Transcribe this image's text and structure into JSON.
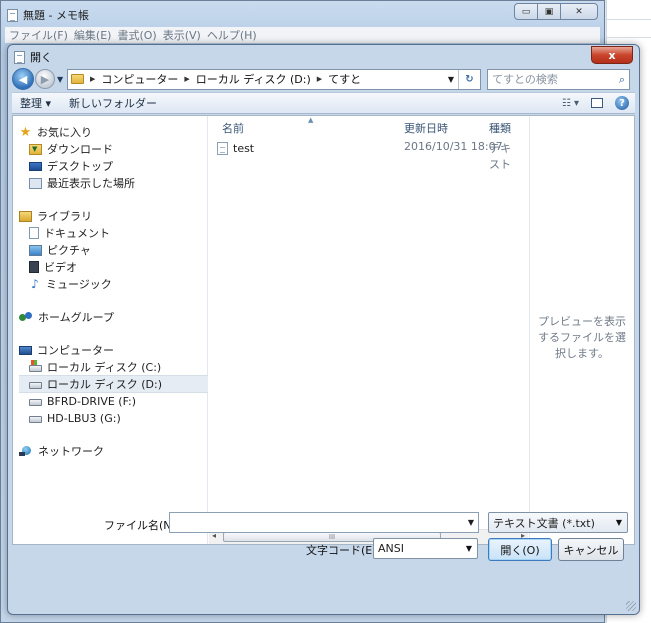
{
  "notepad": {
    "title": "無題 - メモ帳",
    "menu": [
      "ファイル(F)",
      "編集(E)",
      "書式(O)",
      "表示(V)",
      "ヘルプ(H)"
    ],
    "caption_buttons": {
      "minimize": "▭",
      "maximize": "▣",
      "close": "✕"
    }
  },
  "dialog": {
    "title": "開く",
    "close_glyph": "x",
    "address": {
      "crumbs": [
        "コンピューター",
        "ローカル ディスク (D:)",
        "てすと"
      ],
      "search_placeholder": "てすとの検索"
    },
    "toolbar": {
      "organize": "整理 ▾",
      "new_folder": "新しいフォルダー"
    },
    "nav": {
      "favorites": "お気に入り",
      "downloads": "ダウンロード",
      "desktop": "デスクトップ",
      "recent": "最近表示した場所",
      "libraries": "ライブラリ",
      "documents": "ドキュメント",
      "pictures": "ピクチャ",
      "videos": "ビデオ",
      "music": "ミュージック",
      "homegroup": "ホームグループ",
      "computer": "コンピューター",
      "drive_c": "ローカル ディスク (C:)",
      "drive_d": "ローカル ディスク (D:)",
      "drive_f": "BFRD-DRIVE (F:)",
      "drive_g": "HD-LBU3 (G:)",
      "network": "ネットワーク",
      "selected": "ローカル ディスク (D:)"
    },
    "columns": {
      "name": "名前",
      "modified": "更新日時",
      "type": "種類"
    },
    "files": [
      {
        "name": "test",
        "modified": "2016/10/31 18:07",
        "type": "テキスト"
      }
    ],
    "preview_text": "プレビューを表示するファイルを選択します。",
    "scroll_thumb": "III",
    "filename_label": "ファイル名(N):",
    "filename_value": "",
    "filetype_value": "テキスト文書 (*.txt)",
    "encoding_label": "文字コード(E):",
    "encoding_value": "ANSI",
    "open_button": "開く(O)",
    "cancel_button": "キャンセル"
  }
}
